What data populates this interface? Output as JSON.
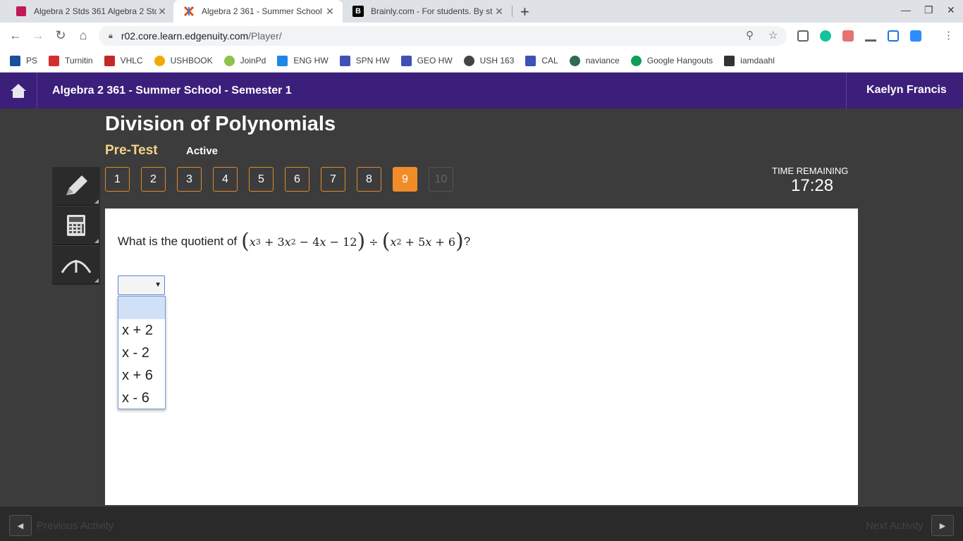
{
  "browser": {
    "tabs": [
      {
        "title": "Algebra 2 Stds 361 Algebra 2 Std",
        "fav_color": "#c2185b"
      },
      {
        "title": "Algebra 2 361 - Summer School",
        "fav_color": "#e64a19"
      },
      {
        "title": "Brainly.com - For students. By st",
        "fav_color": "#000000",
        "fav_text": "B"
      }
    ],
    "new_tab": "+",
    "close_glyph": "✕",
    "url_host": "r02.core.learn.edgenuity.com",
    "url_path": "/Player/",
    "bookmarks": [
      {
        "label": "PS",
        "color": "#1a4f9c"
      },
      {
        "label": "Turnitin",
        "color": "#d32f2f"
      },
      {
        "label": "VHLC",
        "color": "#c62828"
      },
      {
        "label": "USHBOOK",
        "color": "#f2a900"
      },
      {
        "label": "JoinPd",
        "color": "#8bc34a"
      },
      {
        "label": "ENG HW",
        "color": "#1e88e5"
      },
      {
        "label": "SPN HW",
        "color": "#3f51b5"
      },
      {
        "label": "GEO HW",
        "color": "#3f51b5"
      },
      {
        "label": "USH 163",
        "color": "#444444"
      },
      {
        "label": "CAL",
        "color": "#3f51b5"
      },
      {
        "label": "naviance",
        "color": "#2e6b4f"
      },
      {
        "label": "Google Hangouts",
        "color": "#0f9d58"
      },
      {
        "label": "iamdaahl",
        "color": "#333333"
      }
    ]
  },
  "header": {
    "course": "Algebra 2 361 - Summer School - Semester 1",
    "user": "Kaelyn Francis"
  },
  "lesson": {
    "title": "Division of Polynomials",
    "type": "Pre-Test",
    "status": "Active",
    "questions": [
      "1",
      "2",
      "3",
      "4",
      "5",
      "6",
      "7",
      "8",
      "9",
      "10"
    ],
    "current_question": "9",
    "timer_label": "TIME REMAINING",
    "timer": "17:28"
  },
  "question": {
    "prefix": "What is the quotient of",
    "suffix": "?",
    "options": [
      "x + 2",
      "x - 2",
      "x + 6",
      "x - 6"
    ]
  },
  "footer": {
    "previous": "Previous Activity",
    "next": "Next Activity"
  }
}
